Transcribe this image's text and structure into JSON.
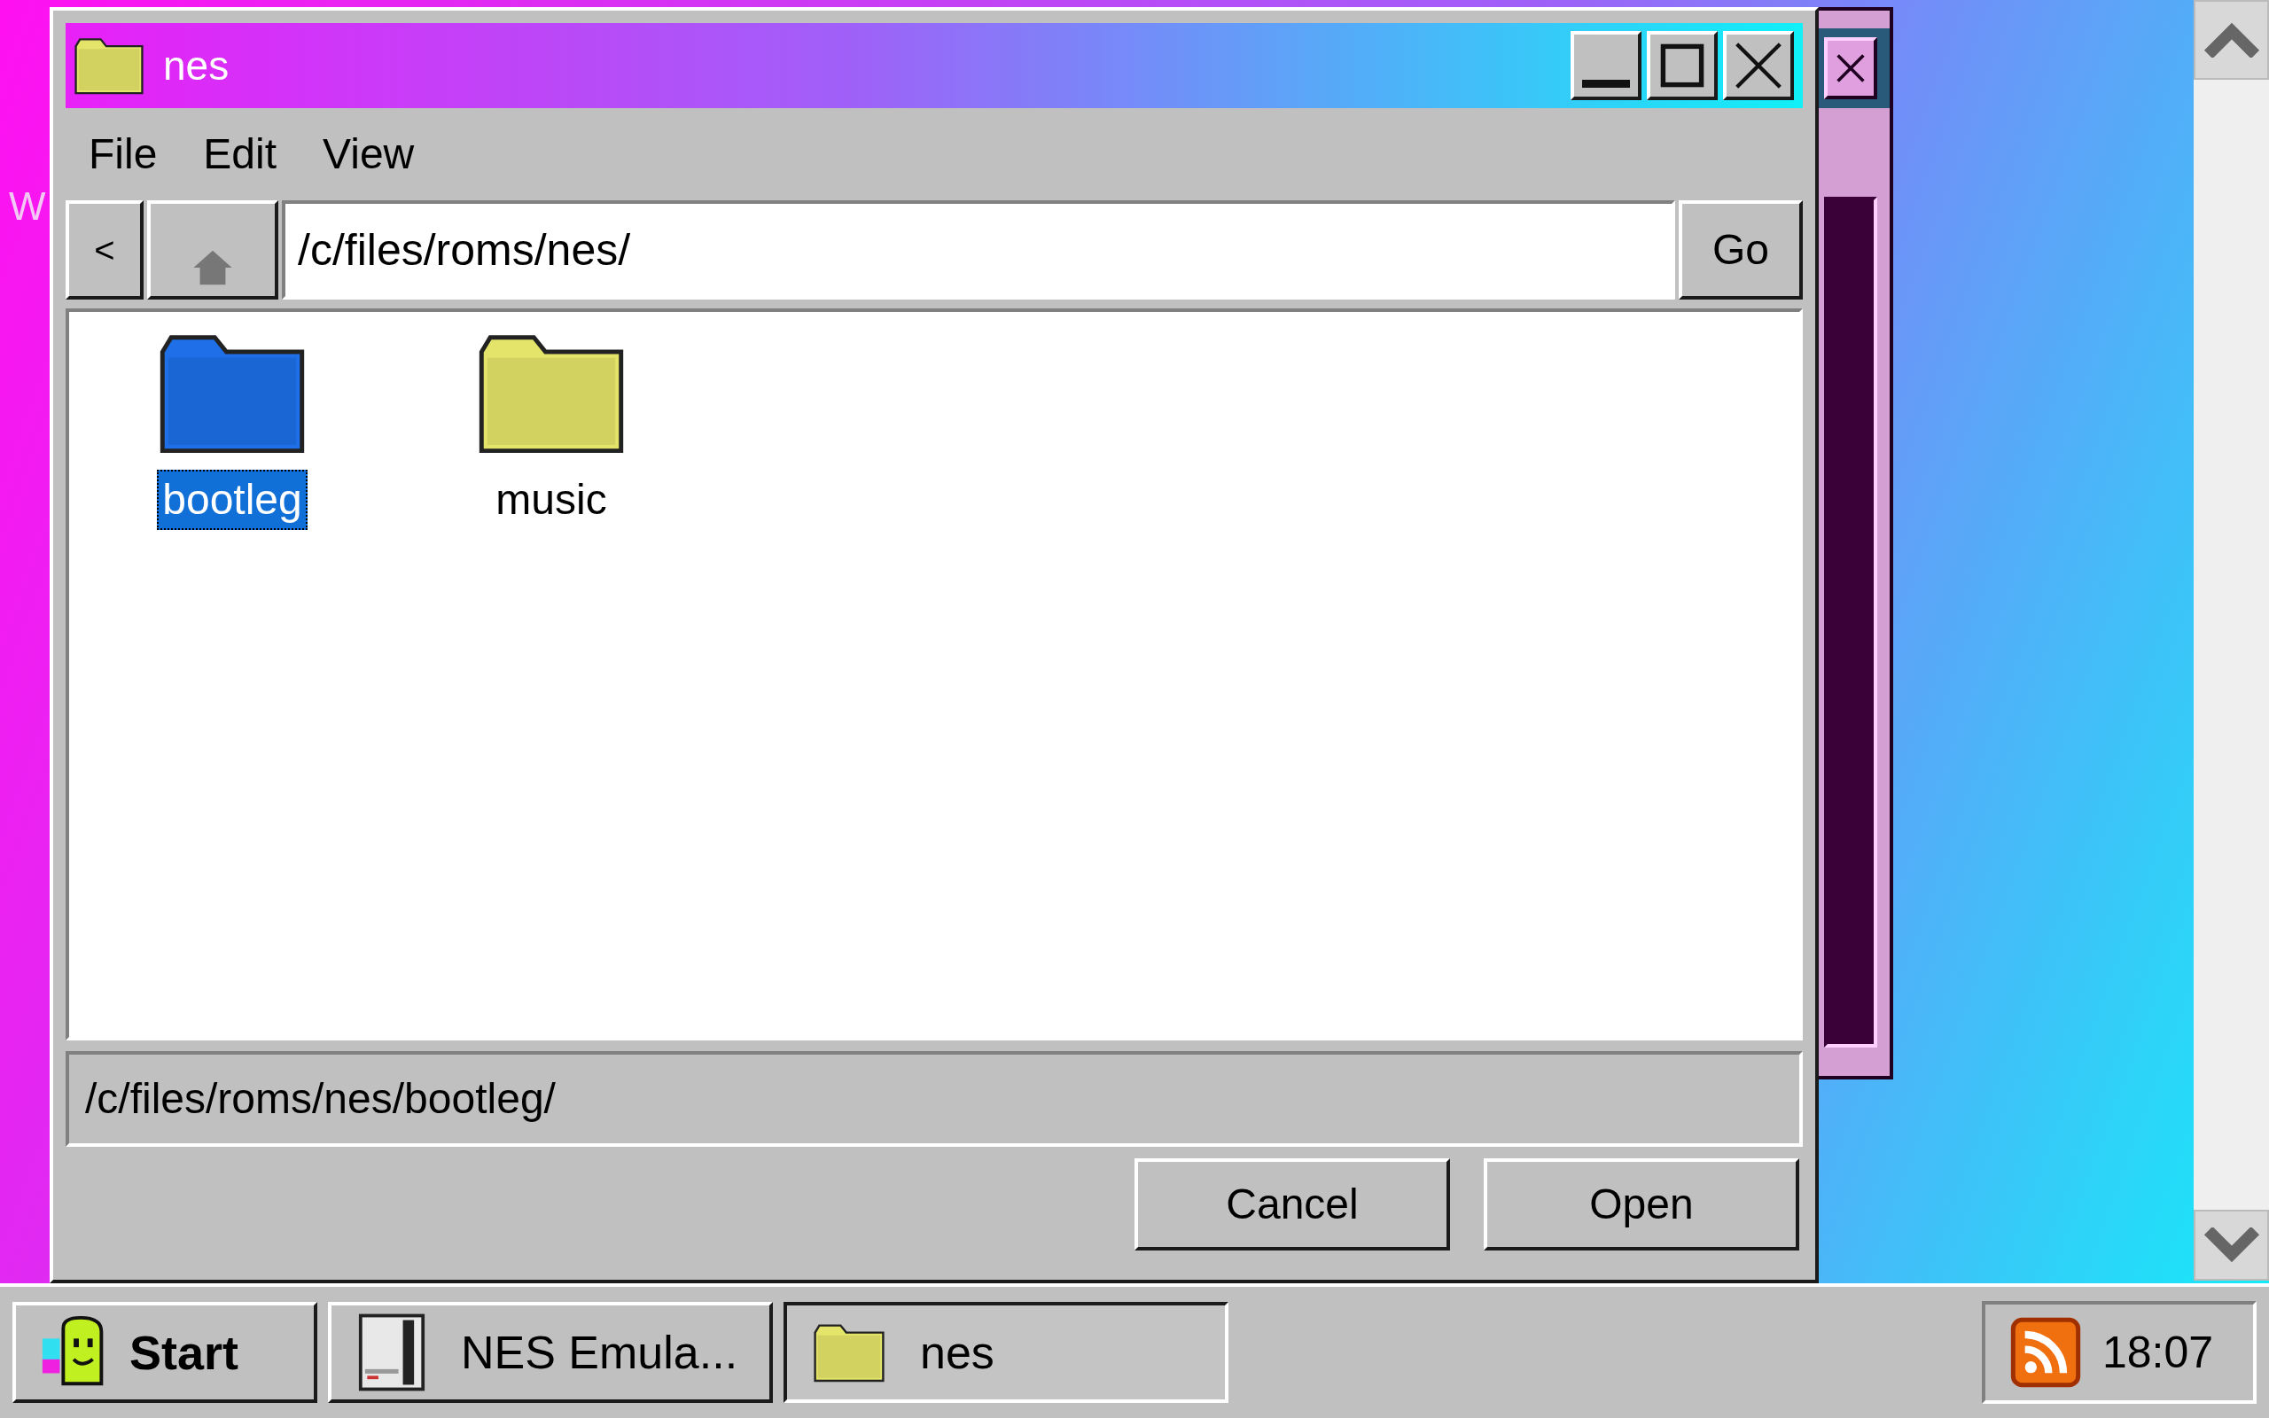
{
  "desktop": {
    "icon_label": "W"
  },
  "window": {
    "title": "nes",
    "menu": [
      "File",
      "Edit",
      "View"
    ],
    "back": "<",
    "address": "/c/files/roms/nes/",
    "go": "Go",
    "files": [
      {
        "name": "bootleg",
        "color": "#1e6fe8",
        "selected": true
      },
      {
        "name": "music",
        "color": "#e4e46a",
        "selected": false
      }
    ],
    "status": "/c/files/roms/nes/bootleg/",
    "buttons": [
      "Cancel",
      "Open"
    ]
  },
  "taskbar": {
    "start": "Start",
    "tasks": [
      {
        "label": "NES Emula...",
        "kind": "console",
        "selected": false
      },
      {
        "label": "nes",
        "kind": "folder",
        "selected": true
      }
    ],
    "clock": "18:07"
  }
}
